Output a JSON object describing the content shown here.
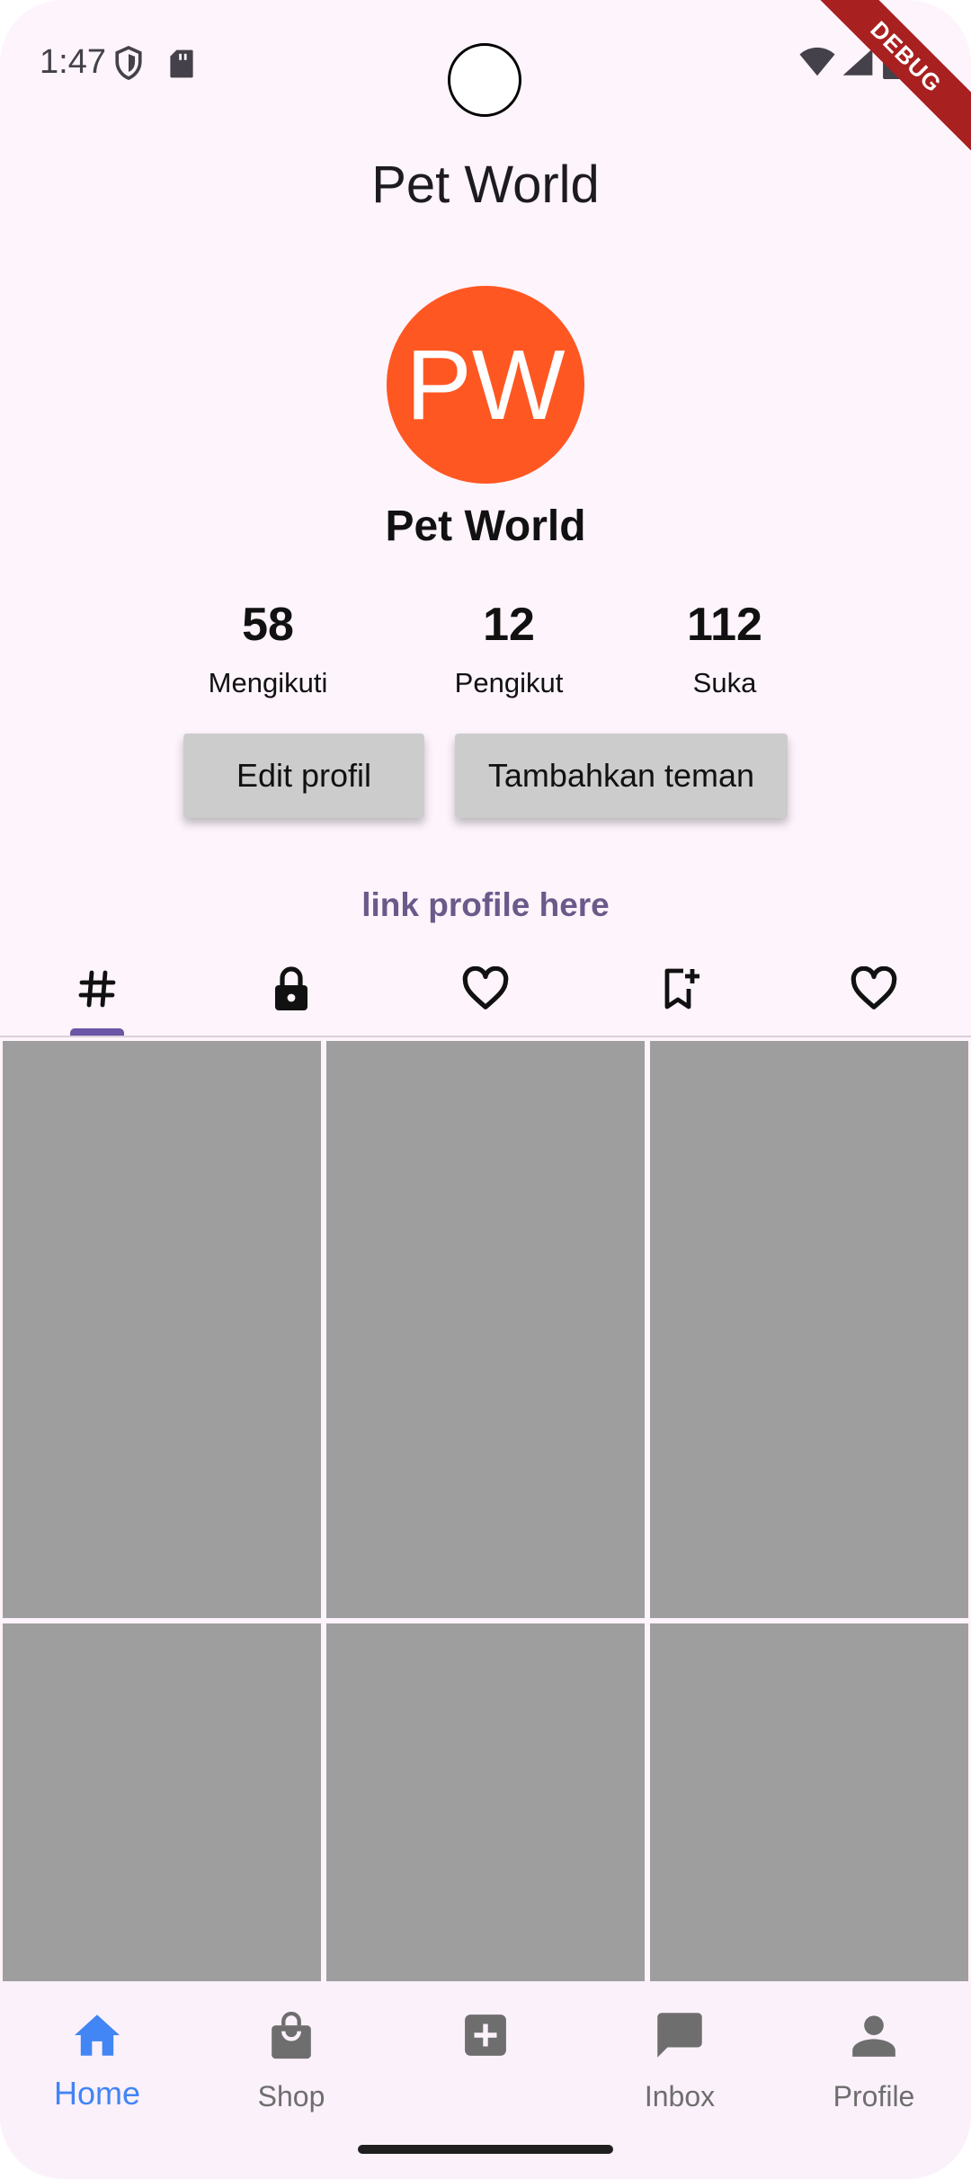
{
  "status_bar": {
    "time": "1:47",
    "debug_label": "DEBUG",
    "icons": [
      "shield-icon",
      "sd-card-icon",
      "wifi-icon",
      "signal-icon",
      "battery-icon"
    ]
  },
  "app_bar": {
    "title": "Pet World"
  },
  "profile": {
    "avatar_initials": "PW",
    "avatar_color": "#ff5722",
    "name": "Pet World",
    "stats": [
      {
        "value": "58",
        "label": "Mengikuti"
      },
      {
        "value": "12",
        "label": "Pengikut"
      },
      {
        "value": "112",
        "label": "Suka"
      }
    ],
    "edit_button_label": "Edit profil",
    "add_friend_button_label": "Tambahkan teman",
    "link_text": "link profile here"
  },
  "tabs": [
    {
      "icon": "hashtag-icon",
      "selected": true
    },
    {
      "icon": "lock-icon",
      "selected": false
    },
    {
      "icon": "heart-icon",
      "selected": false
    },
    {
      "icon": "bookmark-add-icon",
      "selected": false
    },
    {
      "icon": "heart-icon",
      "selected": false
    }
  ],
  "grid_color": "#9e9e9e",
  "bottom_nav": {
    "active_color": "#4285f4",
    "items": [
      {
        "label": "Home",
        "icon": "home-icon",
        "active": true
      },
      {
        "label": "Shop",
        "icon": "shopping-bag-icon",
        "active": false
      },
      {
        "label": "",
        "icon": "add-box-icon",
        "active": false
      },
      {
        "label": "Inbox",
        "icon": "chat-bubble-icon",
        "active": false
      },
      {
        "label": "Profile",
        "icon": "person-icon",
        "active": false
      }
    ]
  }
}
